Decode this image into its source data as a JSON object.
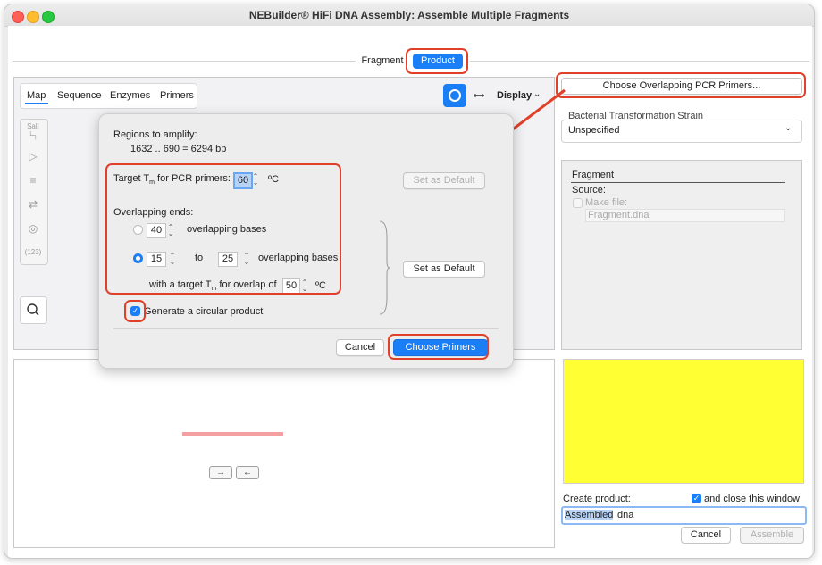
{
  "window": {
    "title": "NEBuilder® HiFi DNA Assembly: Assemble Multiple Fragments"
  },
  "segment": {
    "fragment": "Fragment",
    "product": "Product"
  },
  "map_tabs": [
    "Map",
    "Sequence",
    "Enzymes",
    "Primers"
  ],
  "display": {
    "label": "Display"
  },
  "tools": {
    "sall": "SalI",
    "num": "(123)"
  },
  "right": {
    "choose_overlapping": "Choose Overlapping PCR Primers...",
    "strain_label": "Bacterial Transformation Strain",
    "strain_value": "Unspecified",
    "fragment_title": "Fragment",
    "source_label": "Source:",
    "make_file_label": "Make file:",
    "make_file_value": "Fragment.dna",
    "create_product_label": "Create product:",
    "close_window_label": "and close this window",
    "product_name_selected": "Assembled",
    "product_name_ext": ".dna",
    "cancel": "Cancel",
    "assemble": "Assemble",
    "preview_color": "#ffff33"
  },
  "popover": {
    "regions_label": "Regions to amplify:",
    "regions_value": "1632 .. 690  =  6294 bp",
    "target_tm_label": "Target T",
    "target_tm_sub": "m",
    "target_tm_rest": " for PCR primers:",
    "target_tm_value": "60",
    "unit_c": "ºC",
    "overlapping_ends": "Overlapping ends:",
    "opt1_value": "40",
    "opt1_label": "overlapping bases",
    "opt2_from": "15",
    "opt2_to_label": "to",
    "opt2_to": "25",
    "opt2_label": "overlapping bases",
    "overlap_tm_label_a": "with a target T",
    "overlap_tm_sub": "m",
    "overlap_tm_label_b": " for overlap of",
    "overlap_tm_value": "50",
    "generate_circular": "Generate a circular product",
    "set_default_1": "Set as Default",
    "set_default_2": "Set as Default",
    "cancel": "Cancel",
    "choose_primers": "Choose Primers"
  },
  "colors": {
    "accent": "#1a7ff7",
    "annotation": "#e0402a",
    "fragment_bar": "#f4a0a0"
  }
}
